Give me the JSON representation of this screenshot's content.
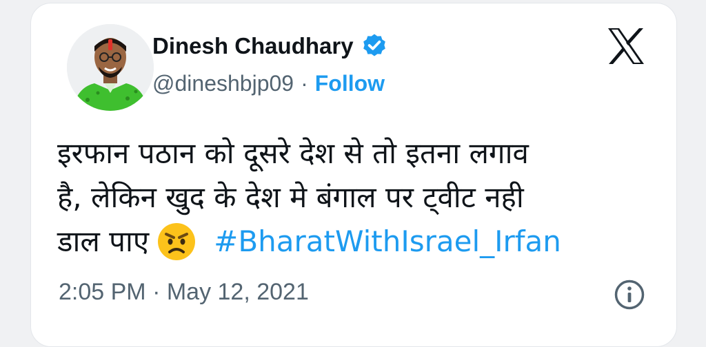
{
  "author": {
    "display_name": "Dinesh Chaudhary",
    "handle": "@dineshbjp09",
    "separator": "·",
    "follow_label": "Follow",
    "verified": true,
    "avatar_icon": "profile-photo"
  },
  "tweet": {
    "text_line_1": "इरफान पठान को दूसरे देश से तो इतना लगाव",
    "text_line_2": "है, लेकिन खुद के देश मे बंगाल पर ट्वीट नही",
    "text_line_3": "डाल पाए",
    "emoji": "angry-face",
    "hashtag": "#BharatWithIsrael_Irfan"
  },
  "footer": {
    "timestamp": "2:05 PM · May 12, 2021",
    "info_icon": "info-icon"
  },
  "colors": {
    "accent": "#1d9bf0",
    "text": "#0f1419",
    "secondary": "#536471",
    "card_bg": "#ffffff",
    "page_bg": "#f0f1f3"
  }
}
